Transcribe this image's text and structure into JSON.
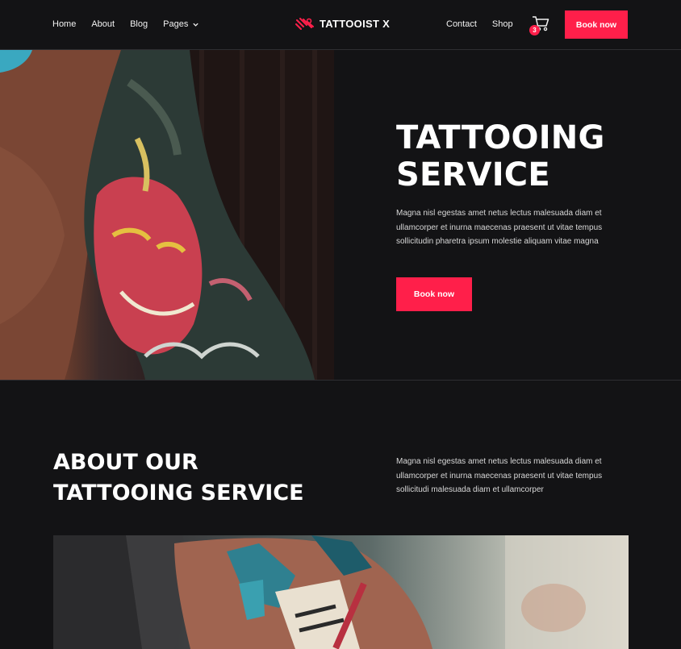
{
  "header": {
    "nav_left": [
      {
        "label": "Home"
      },
      {
        "label": "About"
      },
      {
        "label": "Blog"
      },
      {
        "label": "Pages",
        "has_dropdown": true
      }
    ],
    "logo_text": "TATTOOIST X",
    "nav_right": [
      {
        "label": "Contact"
      },
      {
        "label": "Shop"
      }
    ],
    "cart_count": "3",
    "book_label": "Book now"
  },
  "hero": {
    "title_line1": "TATTOOING",
    "title_line2": "SERVICE",
    "text": "Magna nisl egestas amet netus lectus malesuada diam et ullamcorper et inurna maecenas praesent ut vitae tempus sollicitudin pharetra ipsum molestie  aliquam vitae magna",
    "button_label": "Book now",
    "image_icon": "tattooed-arm-photo"
  },
  "about": {
    "title_line1": "ABOUT OUR",
    "title_line2": "TATTOOING SERVICE",
    "text": "Magna nisl egestas amet netus lectus malesuada diam et ullamcorper et inurna maecenas praesent ut vitae tempus sollicitudi malesuada diam et ullamcorper",
    "image_icon": "tattooed-forearm-photo"
  },
  "colors": {
    "background": "#131315",
    "accent": "#ff1f4a",
    "text": "#ffffff",
    "muted_text": "#d8d8d8"
  }
}
